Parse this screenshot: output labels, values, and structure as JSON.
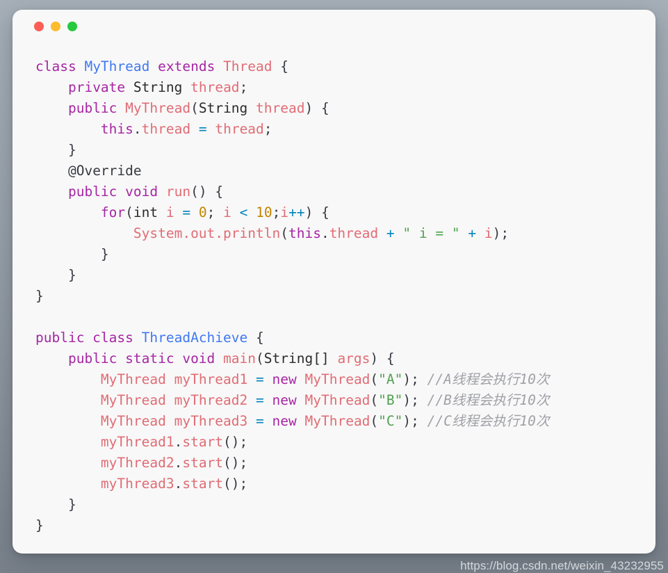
{
  "window": {
    "name": "code-snippet-window",
    "background_color": "#f8f8f8",
    "page_background_top": "#a7b0b8",
    "page_background_bottom": "#79818a",
    "traffic_lights": [
      {
        "name": "close",
        "color": "#fc5d55"
      },
      {
        "name": "minimize",
        "color": "#fdbc2e"
      },
      {
        "name": "maximize",
        "color": "#27c93f"
      }
    ]
  },
  "palette": {
    "keyword": "#a626a4",
    "class_name": "#4078f2",
    "identifier": "#e06c75",
    "operator": "#0184bc",
    "number": "#c18401",
    "string": "#50a14f",
    "comment": "#a0a1a7",
    "punctuation": "#383a42",
    "plain": "#2b2b2b"
  },
  "code": {
    "language": "java",
    "lines": [
      {
        "n": 1,
        "text": "class MyThread extends Thread {"
      },
      {
        "n": 2,
        "text": "    private String thread;"
      },
      {
        "n": 3,
        "text": "    public MyThread(String thread) {"
      },
      {
        "n": 4,
        "text": "        this.thread = thread;"
      },
      {
        "n": 5,
        "text": "    }"
      },
      {
        "n": 6,
        "text": "    @Override"
      },
      {
        "n": 7,
        "text": "    public void run() {"
      },
      {
        "n": 8,
        "text": "        for(int i = 0; i < 10;i++) {"
      },
      {
        "n": 9,
        "text": "            System.out.println(this.thread + \" i = \" + i);"
      },
      {
        "n": 10,
        "text": "        }"
      },
      {
        "n": 11,
        "text": "    }"
      },
      {
        "n": 12,
        "text": "}"
      },
      {
        "n": 13,
        "text": ""
      },
      {
        "n": 14,
        "text": "public class ThreadAchieve {"
      },
      {
        "n": 15,
        "text": "    public static void main(String[] args) {"
      },
      {
        "n": 16,
        "text": "        MyThread myThread1 = new MyThread(\"A\"); //A线程会执行10次"
      },
      {
        "n": 17,
        "text": "        MyThread myThread2 = new MyThread(\"B\"); //B线程会执行10次"
      },
      {
        "n": 18,
        "text": "        MyThread myThread3 = new MyThread(\"C\"); //C线程会执行10次"
      },
      {
        "n": 19,
        "text": "        myThread1.start();"
      },
      {
        "n": 20,
        "text": "        myThread2.start();"
      },
      {
        "n": 21,
        "text": "        myThread3.start();"
      },
      {
        "n": 22,
        "text": "    }"
      },
      {
        "n": 23,
        "text": "}"
      }
    ],
    "tokens": {
      "l1": {
        "kw1": "class",
        "cls": "MyThread",
        "kw2": "extends",
        "type": "Thread",
        "brace": "{"
      },
      "l2": {
        "kw": "private",
        "type": "String",
        "ident": "thread",
        "semi": ";"
      },
      "l3": {
        "kw": "public",
        "ident": "MyThread",
        "type": "String",
        "param": "thread",
        "brace": "{"
      },
      "l4": {
        "kw": "this",
        "field": "thread",
        "op": "=",
        "val": "thread",
        "semi": ";"
      },
      "l6": {
        "annotation": "@Override"
      },
      "l7": {
        "kw": "public void",
        "method": "run",
        "brace": "{"
      },
      "l8": {
        "kw": "for",
        "type": "int",
        "var": "i",
        "init": "0",
        "limit": "10",
        "inc": "i++"
      },
      "l9": {
        "call": "System.out.println",
        "kw": "this",
        "field": "thread",
        "str": "\" i = \"",
        "var": "i"
      },
      "l14": {
        "kw": "public class",
        "cls": "ThreadAchieve",
        "brace": "{"
      },
      "l15": {
        "kw": "public static void",
        "method": "main",
        "type": "String[]",
        "param": "args"
      },
      "l16": {
        "type": "MyThread",
        "var": "myThread1",
        "kw": "new",
        "str": "\"A\"",
        "comment": "//A线程会执行10次"
      },
      "l17": {
        "type": "MyThread",
        "var": "myThread2",
        "kw": "new",
        "str": "\"B\"",
        "comment": "//B线程会执行10次"
      },
      "l18": {
        "type": "MyThread",
        "var": "myThread3",
        "kw": "new",
        "str": "\"C\"",
        "comment": "//C线程会执行10次"
      },
      "l19": {
        "var": "myThread1",
        "method": "start"
      },
      "l20": {
        "var": "myThread2",
        "method": "start"
      },
      "l21": {
        "var": "myThread3",
        "method": "start"
      }
    }
  },
  "watermark": {
    "text": "https://blog.csdn.net/weixin_43232955"
  }
}
